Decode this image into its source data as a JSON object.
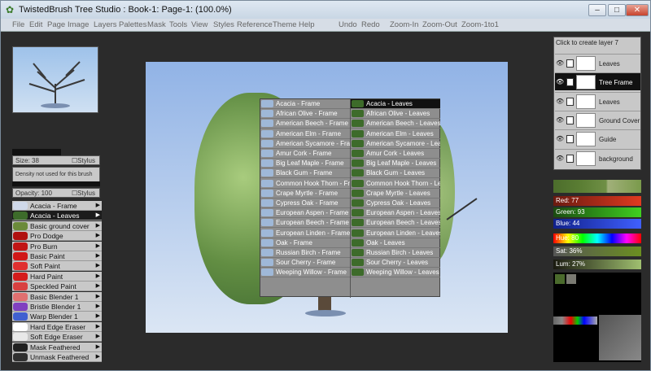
{
  "window": {
    "title": "TwistedBrush Tree Studio : Book-1: Page-1:  (100.0%)",
    "controls": {
      "minimize": "–",
      "maximize": "□",
      "close": "✕"
    }
  },
  "menu": [
    "File",
    "Edit",
    "Page",
    "Image",
    "Layers",
    "Palettes",
    "Mask",
    "Tools",
    "View",
    "Styles",
    "Reference",
    "Theme",
    "Help",
    "Undo",
    "Redo",
    "Zoom-In",
    "Zoom-Out",
    "Zoom-1to1"
  ],
  "left": {
    "size_label": "Size: 38",
    "stylus1": "Stylus",
    "density_note": "Density not used for this brush",
    "opacity_label": "Opacity: 100",
    "stylus2": "Stylus",
    "brushes": [
      {
        "label": "Acacia - Frame",
        "color": "#cfd8e8"
      },
      {
        "label": "Acacia - Leaves",
        "color": "#3d6b2a",
        "selected": true
      },
      {
        "label": "Basic ground cover",
        "color": "#6b8a3a"
      },
      {
        "label": "Pro Dodge",
        "color": "#b01010"
      },
      {
        "label": "Pro Burn",
        "color": "#c01515"
      },
      {
        "label": "Basic Paint",
        "color": "#d01818"
      },
      {
        "label": "Soft Paint",
        "color": "#e03030"
      },
      {
        "label": "Hard Paint",
        "color": "#d41c1c"
      },
      {
        "label": "Speckled Paint",
        "color": "#d84040"
      },
      {
        "label": "Basic Blender 1",
        "color": "#e07070"
      },
      {
        "label": "Bristle Blender 1",
        "color": "#8040c0"
      },
      {
        "label": "Warp Blender 1",
        "color": "#4060d0"
      },
      {
        "label": "Hard Edge Eraser",
        "color": "#ffffff"
      },
      {
        "label": "Soft Edge Eraser",
        "color": "#e8e8e8"
      },
      {
        "label": "Mask Feathered",
        "color": "#202020"
      },
      {
        "label": "Unmask Feathered",
        "color": "#303030"
      }
    ]
  },
  "treemenu": {
    "frames": [
      "Acacia - Frame",
      "African Olive - Frame",
      "American Beech - Frame",
      "American Elm - Frame",
      "American Sycamore - Frame",
      "Amur Cork - Frame",
      "Big Leaf Maple - Frame",
      "Black Gum - Frame",
      "Common Hook Thorn - Frame",
      "Crape Myrtle - Frame",
      "Cypress Oak - Frame",
      "European Aspen - Frame",
      "European Beech - Frame",
      "European Linden - Frame",
      "Oak - Frame",
      "Russian Birch - Frame",
      "Sour Cherry - Frame",
      "Weeping Willow - Frame"
    ],
    "leaves": [
      "Acacia - Leaves",
      "African Olive - Leaves",
      "American Beech - Leaves",
      "American Elm - Leaves",
      "American Sycamore - Leaves",
      "Amur Cork - Leaves",
      "Big Leaf Maple - Leaves",
      "Black Gum - Leaves",
      "Common Hook Thorn - Leaves",
      "Crape Myrtle - Leaves",
      "Cypress Oak - Leaves",
      "European Aspen - Leaves",
      "European Beech - Leaves",
      "European Linden - Leaves",
      "Oak - Leaves",
      "Russian Birch - Leaves",
      "Sour Cherry - Leaves",
      "Weeping Willow - Leaves"
    ]
  },
  "layers": {
    "header": "Click to create layer 7",
    "items": [
      {
        "name": "Leaves"
      },
      {
        "name": "Tree Frame",
        "selected": true
      },
      {
        "name": "Leaves"
      },
      {
        "name": "Ground Cover"
      },
      {
        "name": "Guide"
      },
      {
        "name": "background"
      }
    ]
  },
  "color": {
    "red": "Red: 77",
    "green": "Green: 93",
    "blue": "Blue: 44",
    "hue": "Hue: 80",
    "sat": "Sat: 36%",
    "lum": "Lum: 27%"
  }
}
